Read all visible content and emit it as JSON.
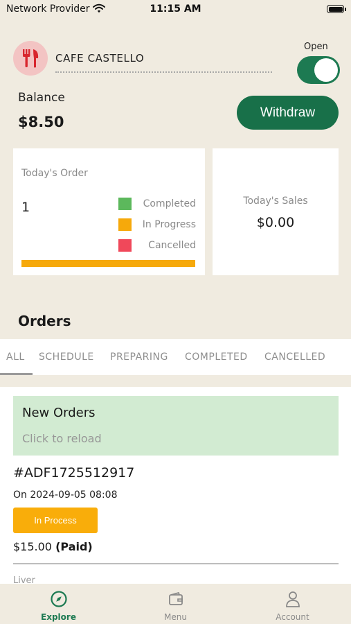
{
  "status_bar": {
    "carrier": "Network Provider",
    "time": "11:15 AM"
  },
  "header": {
    "restaurant_name": "CAFE CASTELLO",
    "open_label": "Open",
    "is_open": true,
    "logo_icon": "fork-knife-icon"
  },
  "balance": {
    "label": "Balance",
    "value": "$8.50",
    "withdraw_label": "Withdraw"
  },
  "today_order": {
    "label": "Today's Order",
    "count": "1",
    "legend": [
      {
        "label": "Completed",
        "color": "#5cb85c"
      },
      {
        "label": "In Progress",
        "color": "#f6a90b"
      },
      {
        "label": "Cancelled",
        "color": "#f0485a"
      }
    ],
    "progress_fraction": 1.0,
    "progress_color": "#f6a90b"
  },
  "today_sales": {
    "label": "Today's Sales",
    "value": "$0.00"
  },
  "orders": {
    "title": "Orders",
    "tabs": [
      {
        "label": "ALL",
        "active": true
      },
      {
        "label": "SCHEDULE"
      },
      {
        "label": "PREPARING"
      },
      {
        "label": "COMPLETED"
      },
      {
        "label": "CANCELLED"
      }
    ],
    "new_orders": {
      "title": "New Orders",
      "subtitle": "Click to reload"
    },
    "items": [
      {
        "id": "#ADF1725512917",
        "date": "On 2024-09-05 08:08",
        "status": "In Process",
        "amount": "$15.00",
        "payment": "(Paid)"
      }
    ],
    "next_item_text": "Liver"
  },
  "bottom_nav": [
    {
      "label": "Explore",
      "icon": "compass-icon",
      "active": true
    },
    {
      "label": "Menu",
      "icon": "wallet-icon"
    },
    {
      "label": "Account",
      "icon": "person-icon"
    }
  ],
  "colors": {
    "accent": "#187049",
    "background": "#f0ebe0",
    "status_in_process": "#f9ad0a",
    "new_orders_bg": "#d2ebd2"
  }
}
